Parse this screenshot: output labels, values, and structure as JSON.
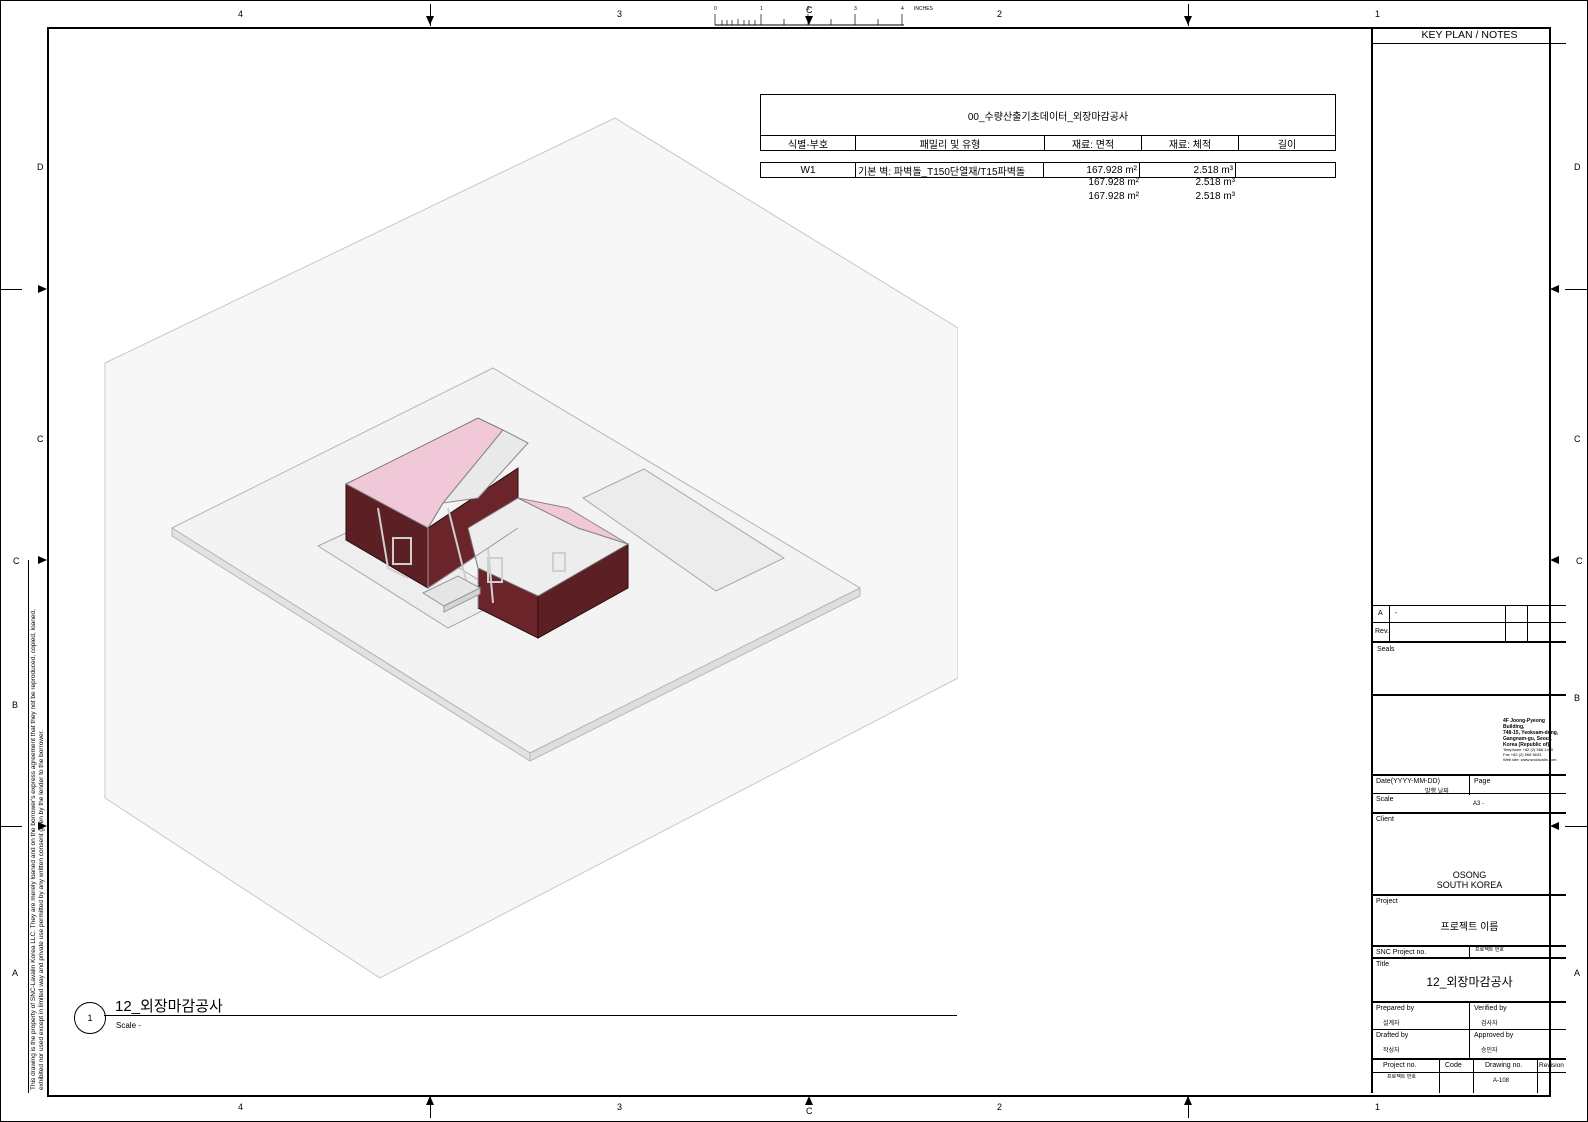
{
  "border": {
    "top_columns": [
      "4",
      "3",
      "2",
      "1"
    ],
    "bottom_columns": [
      "4",
      "3",
      "2",
      "1"
    ],
    "left_rows": [
      "D",
      "C",
      "B",
      "A"
    ],
    "right_rows": [
      "D",
      "C",
      "B",
      "A"
    ],
    "center_marker": "C",
    "ruler_labels": [
      "0",
      "1",
      "2",
      "3",
      "4"
    ],
    "ruler_unit": "INCHES"
  },
  "schedule": {
    "title": "00_수량산출기초데이터_외장마감공사",
    "headers": [
      "식별-부호",
      "패밀리 및 유형",
      "재료: 면적",
      "재료: 체적",
      "길이"
    ],
    "row": {
      "mark": "W1",
      "type": "기본 벽: 파벽돌_T150단열재/T15파벽돌",
      "area": "167.928 m²",
      "volume": "2.518 m³",
      "length": ""
    },
    "subtotals": [
      {
        "area": "167.928 m²",
        "volume": "2.518 m³"
      },
      {
        "area": "167.928 m²",
        "volume": "2.518 m³"
      }
    ]
  },
  "view": {
    "number": "1",
    "title": "12_외장마감공사",
    "scale": "Scale -"
  },
  "disclaimer": "This drawing is the property of SNC-Lavalin Korea LLC. They are merely loaned and on the borrower's express agreement that they not be reproduced, copied, loaned, exhibited nor used except in limited way and private use permitted by any written consent given by the lender to the borrower.",
  "title_block": {
    "header": "KEY PLAN / NOTES",
    "rev_letter": "A",
    "rev_dash": "-",
    "rev_label": "Rev.",
    "seals_label": "Seals",
    "address": [
      "4F Joong-Pyeong Building,",
      "748-15, Yeoksam-dong,",
      "Gangnam-gu, Seoul,",
      "Korea (Republic of)"
    ],
    "contact": [
      "Telephone  +82 (2) 568 1400",
      "Fax          +82 (2) 568 5633",
      "Web site: www.snclavalin.com"
    ],
    "date_label": "Date(YYYY-MM-DD)",
    "date_value": "발행 날짜",
    "page_label": "Page",
    "scale_label": "Scale",
    "scale_value": "A3 -",
    "client_label": "Client",
    "client_line1": "OSONG",
    "client_line2": "SOUTH KOREA",
    "project_label": "Project",
    "project_name": "프로젝트 이름",
    "snc_project_label": "SNC Project no.",
    "snc_project_value": "프로젝트 번호",
    "title_label": "Title",
    "title_value": "12_외장마감공사",
    "prepared_label": "Prepared by",
    "prepared_value": "설계자",
    "verified_label": "Verified by",
    "verified_value": "검사자",
    "drafted_label": "Drafted by",
    "drafted_value": "작성자",
    "approved_label": "Approved by",
    "approved_value": "승인자",
    "projno_label": "Project no.",
    "code_label": "Code",
    "drawno_label": "Drawing no.",
    "revision_label": "Revision",
    "projno_value": "프로젝트 번호",
    "drawno_value": "A-108"
  }
}
